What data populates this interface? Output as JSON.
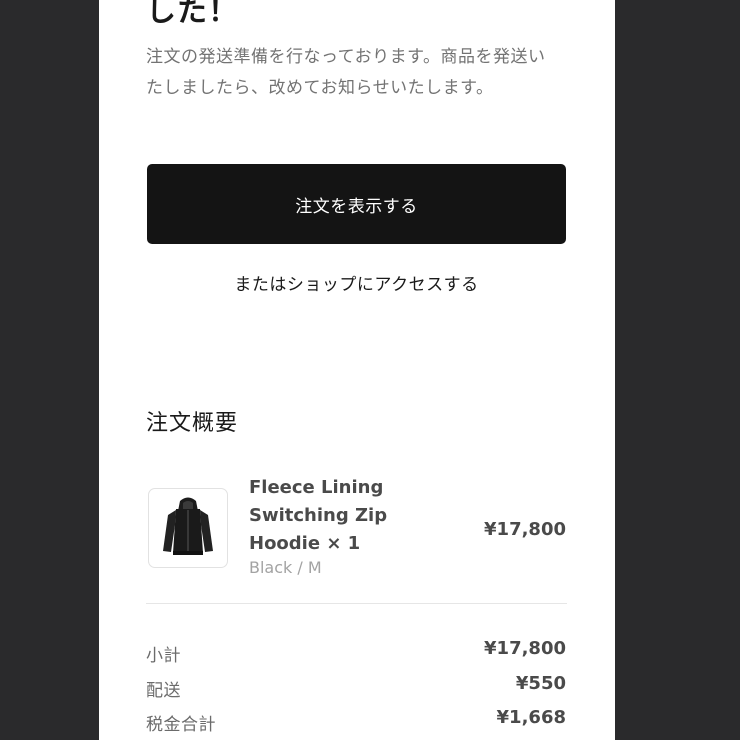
{
  "email": {
    "headline": "した！",
    "message": "注文の発送準備を行なっております。商品を発送いたしましたら、改めてお知らせいたします。",
    "view_order_button": "注文を表示する",
    "shop_link": "またはショップにアクセスする"
  },
  "summary": {
    "title": "注文概要",
    "item": {
      "thumbnail_icon": "hoodie-icon",
      "name": "Fleece Lining Switching Zip Hoodie × 1",
      "variant": "Black / M",
      "price": "¥17,800"
    },
    "rows": [
      {
        "label": "小計",
        "value": "¥17,800"
      },
      {
        "label": "配送",
        "value": "¥550"
      },
      {
        "label": "税金合計",
        "value": "¥1,668"
      }
    ]
  },
  "colors": {
    "background": "#2a2a2c",
    "panel": "#ffffff",
    "button": "#141414",
    "text_primary": "#1a1a1a",
    "text_secondary": "#737373"
  }
}
